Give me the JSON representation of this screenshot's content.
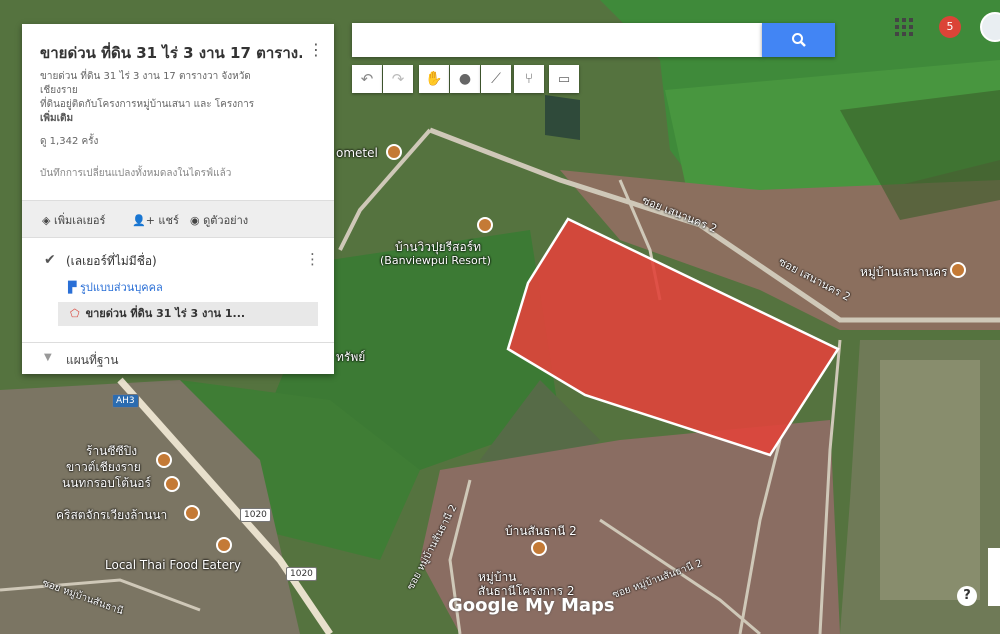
{
  "panel": {
    "title": "ขายด่วน ที่ดิน 31 ไร่ 3 งาน 17 ตาราง...",
    "description_line1": "ขายด่วน ที่ดิน 31 ไร่ 3 งาน 17 ตารางวา จังหวัด",
    "description_line2": "เชียงราย",
    "description_line3": "ที่ดินอยู่ติดกับโครงการหมู่บ้านเสนา และ โครงการ",
    "more_link": "เพิ่มเติม",
    "views": "ดู 1,342 ครั้ง",
    "saved_status": "บันทึกการเปลี่ยนแปลงทั้งหมดลงในไดรฟ์แล้ว",
    "add_layer": "เพิ่มเลเยอร์",
    "share": "แชร์",
    "preview": "ดูตัวอย่าง",
    "layer_name": "(เลเยอร์ที่ไม่มีชื่อ)",
    "layer_style": "รูปแบบส่วนบุคคล",
    "feature_name": "ขายด่วน ที่ดิน 31 ไร่ 3 งาน 1...",
    "base_map": "แผนที่ฐาน"
  },
  "search": {
    "value": "",
    "placeholder": ""
  },
  "toolbar": [
    "undo-icon",
    "redo-icon",
    "hand-icon",
    "marker-icon",
    "draw-line-icon",
    "directions-icon",
    "ruler-icon"
  ],
  "header": {
    "notification_count": "5"
  },
  "map_labels": {
    "resort_th": "บ้านวิวปุยรีสอร์ท",
    "resort_en": "(Banviewpui Resort)",
    "hotel": "ometel",
    "soi_sena_2a": "ซอย เสนานคร 2",
    "soi_sena_2b": "ซอย เสนานคร 2",
    "village_sena": "หมู่บ้านเสนานคร",
    "sap": "ทรัพย์",
    "restaurant1": "ร้านซีซีปิง",
    "restaurant2": "ขาวต์เชียงราย",
    "restaurant3": "นนทกรอบโต้นอร์",
    "church": "คริสตจักรเวียงล้านนา",
    "eatery": "Local Thai Food Eatery",
    "highway_1020a": "1020",
    "highway_1020b": "1020",
    "highway_ah3": "AH3",
    "village_santhani": "บ้านสันธานี 2",
    "village_project": "หมู่บ้าน",
    "village_project2": "สันธานีโครงการ 2",
    "soi_santhani_a": "ซอย หมู่บ้านสันธานี 2",
    "soi_santhani_b": "ซอย หมู่บ้านสันธานี 2",
    "soi_left": "ซอย หมู่บ้านสันธานี",
    "brand": "Google My Maps"
  },
  "colors": {
    "polygon_fill": "#e0443b",
    "polygon_stroke": "#ffffff",
    "search_button": "#4285f4",
    "notification": "#db4437"
  }
}
